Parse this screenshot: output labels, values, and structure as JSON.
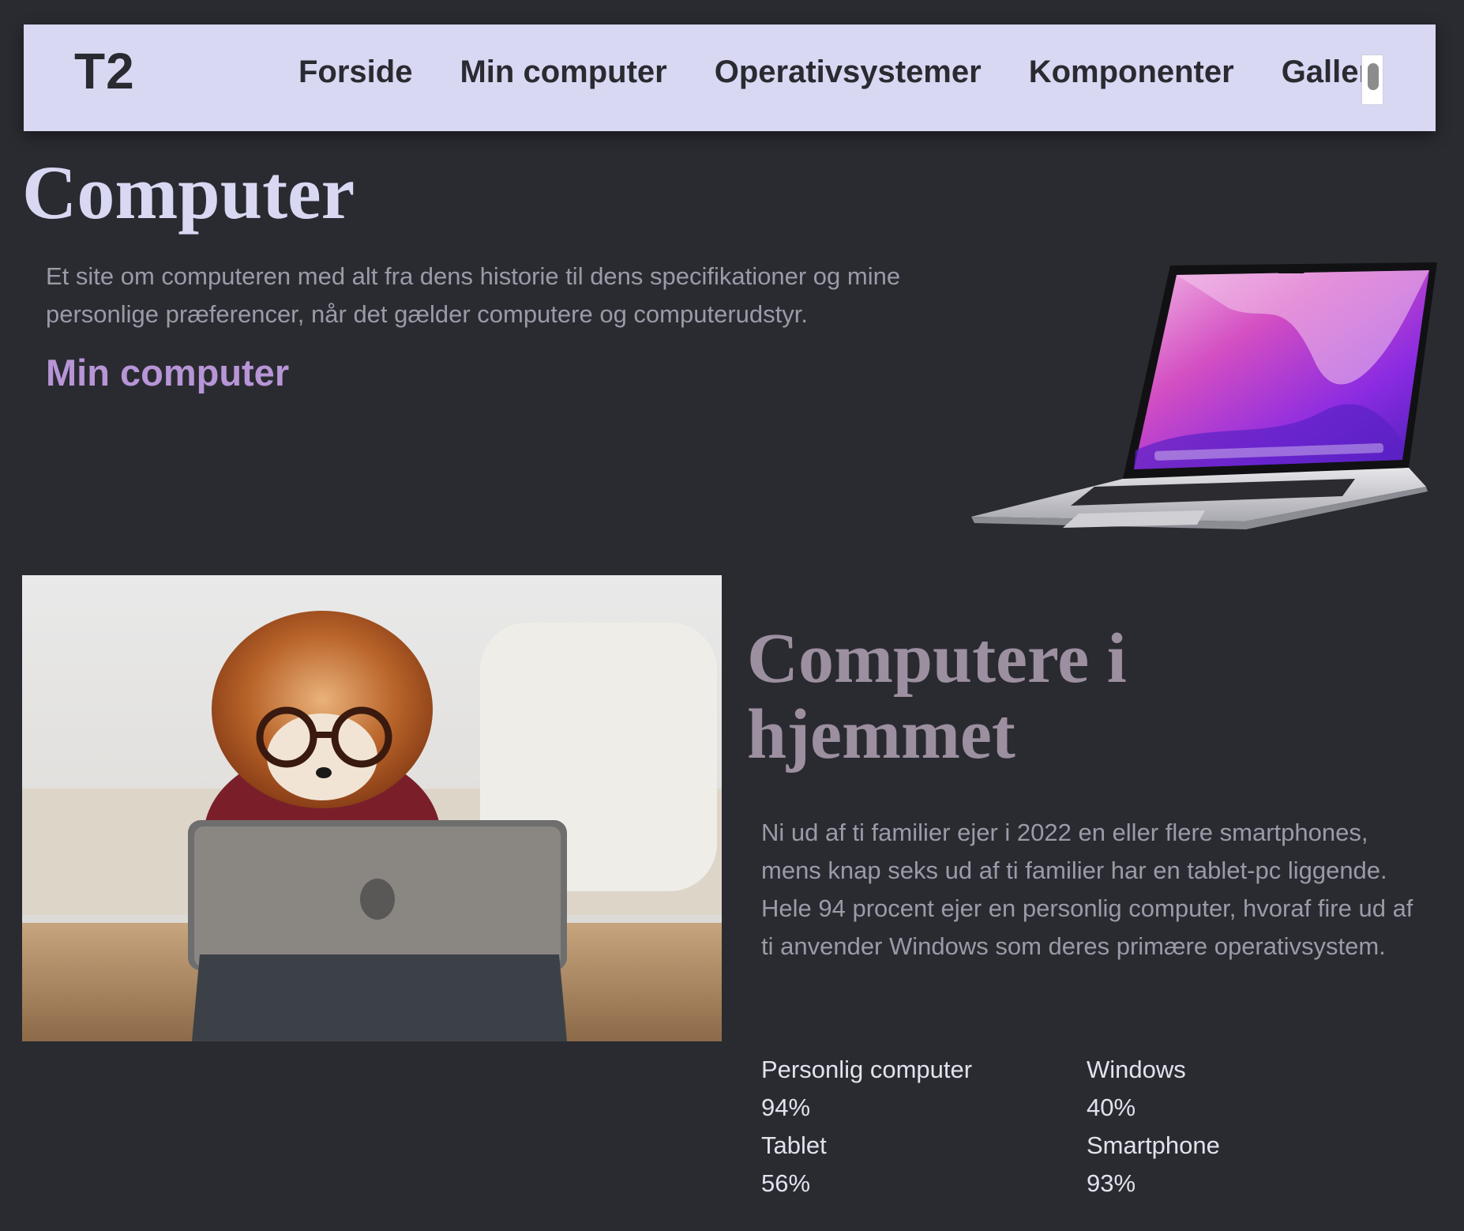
{
  "nav": {
    "logo": "T2",
    "links": [
      "Forside",
      "Min computer",
      "Operativsystemer",
      "Komponenter",
      "Galleri"
    ]
  },
  "hero": {
    "title": "Computer",
    "text": "Et site om computeren med alt fra dens historie til dens specifikationer og mine personlige præferencer, når det gælder computere og computerudstyr.",
    "link": "Min computer"
  },
  "home": {
    "title": "Computere i hjemmet",
    "text": "Ni ud af ti familier ejer i 2022 en eller flere smartphones, mens knap seks ud af ti familier har en tablet-pc liggende. Hele 94 procent ejer en personlig computer, hvoraf fire ud af ti anvender Windows som deres primære operativsystem.",
    "stats": [
      {
        "label": "Personlig computer",
        "value": "94%"
      },
      {
        "label": "Windows",
        "value": "40%"
      },
      {
        "label": "Tablet",
        "value": "56%"
      },
      {
        "label": "Smartphone",
        "value": "93%"
      }
    ]
  },
  "colors": {
    "background": "#2a2b31",
    "nav_bg": "#d8d8f3",
    "accent_link": "#b795d6",
    "section_title": "#9c8fa0"
  }
}
